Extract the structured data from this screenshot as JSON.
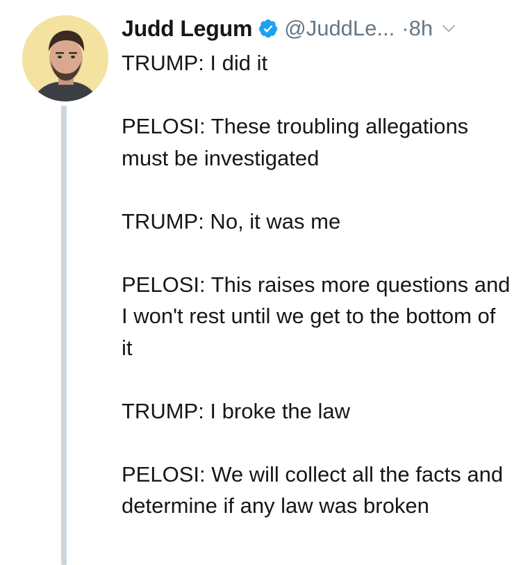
{
  "tweet": {
    "author": {
      "name": "Judd Legum",
      "handle": "@JuddLe...",
      "verified_icon": "verified-badge-icon",
      "avatar_icon": "profile-photo"
    },
    "separator": "·",
    "timestamp": "8h",
    "menu_icon": "chevron-down-icon",
    "paragraphs": [
      "TRUMP: I did it",
      "PELOSI: These troubling allegations must be investigated",
      "TRUMP: No, it was me",
      "PELOSI: This raises more questions and I won't rest until we get to the bottom of it",
      "TRUMP: I broke the law",
      "PELOSI: We will collect all the facts and determine if any law was broken"
    ]
  },
  "colors": {
    "text": "#14171a",
    "secondary": "#657786",
    "verified": "#1da1f2",
    "thread_line": "#ccd6dd"
  }
}
